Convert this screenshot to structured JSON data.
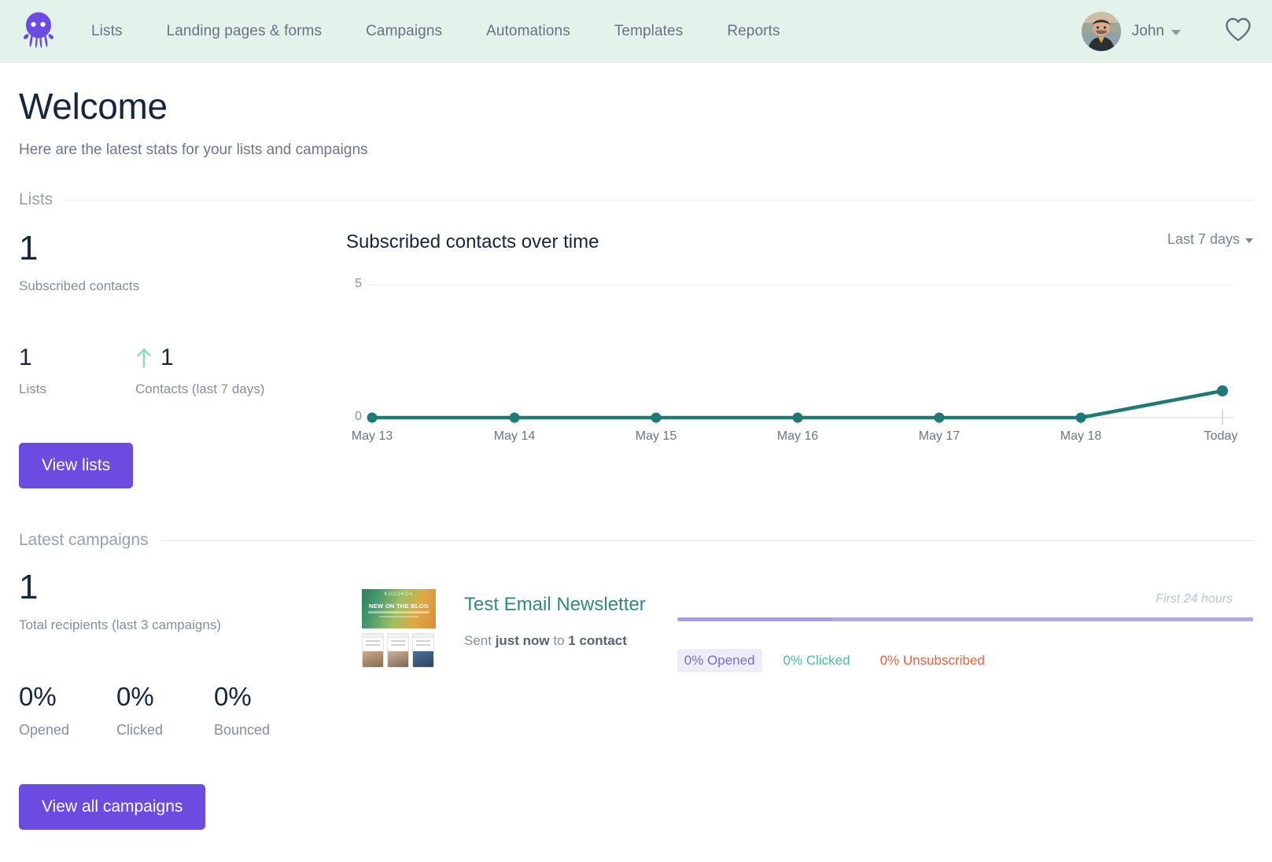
{
  "header": {
    "logo_icon": "octopus-logo-icon",
    "nav": [
      {
        "label": "Lists"
      },
      {
        "label": "Landing pages & forms"
      },
      {
        "label": "Campaigns"
      },
      {
        "label": "Automations"
      },
      {
        "label": "Templates"
      },
      {
        "label": "Reports"
      }
    ],
    "user": {
      "name": "John",
      "avatar_icon": "user-avatar"
    },
    "favorite_icon": "heart-icon",
    "background_color": "#e4f2ec",
    "accent_color": "#6c4ce0"
  },
  "page": {
    "title": "Welcome",
    "subtitle": "Here are the latest stats for your lists and campaigns"
  },
  "lists_section": {
    "heading": "Lists",
    "subscribed_value": "1",
    "subscribed_caption": "Subscribed contacts",
    "lists_value": "1",
    "lists_caption": "Lists",
    "contacts_value": "1",
    "contacts_caption": "Contacts (last 7 days)",
    "trend_icon": "arrow-up-icon",
    "trend_color": "#8fdcc4",
    "view_lists_label": "View lists"
  },
  "chart": {
    "title": "Subscribed contacts over time",
    "range_label": "Last 7 days"
  },
  "chart_data": {
    "type": "line",
    "title": "Subscribed contacts over time",
    "xlabel": "",
    "ylabel": "",
    "categories": [
      "May 13",
      "May 14",
      "May 15",
      "May 16",
      "May 17",
      "May 18",
      "Today"
    ],
    "values": [
      0,
      0,
      0,
      0,
      0,
      0,
      1
    ],
    "ylim": [
      0,
      5
    ],
    "yticks": [
      0,
      5
    ],
    "ytick_labels": [
      "0",
      "5"
    ],
    "grid": true,
    "legend": false,
    "line_color": "#1f7a77",
    "marker": "circle"
  },
  "campaigns_section": {
    "heading": "Latest campaigns",
    "total_value": "1",
    "total_caption": "Total recipients (last 3 campaigns)",
    "metrics": [
      {
        "value": "0%",
        "label": "Opened"
      },
      {
        "value": "0%",
        "label": "Clicked"
      },
      {
        "value": "0%",
        "label": "Bounced"
      }
    ],
    "view_all_label": "View all campaigns",
    "campaign": {
      "name": "Test Email Newsletter",
      "sent_prefix": "Sent ",
      "sent_when": "just now",
      "sent_middle": " to ",
      "sent_count": "1 contact",
      "thumbnail": {
        "brand": "KODOKOA",
        "headline": "NEW ON THE BLOG"
      },
      "timeframe_label": "First 24 hours",
      "chips": [
        {
          "label": "0% Opened",
          "color": "#7a6fc4"
        },
        {
          "label": "0% Clicked",
          "color": "#4cbba4"
        },
        {
          "label": "0% Unsubscribed",
          "color": "#e8633c"
        }
      ]
    }
  }
}
